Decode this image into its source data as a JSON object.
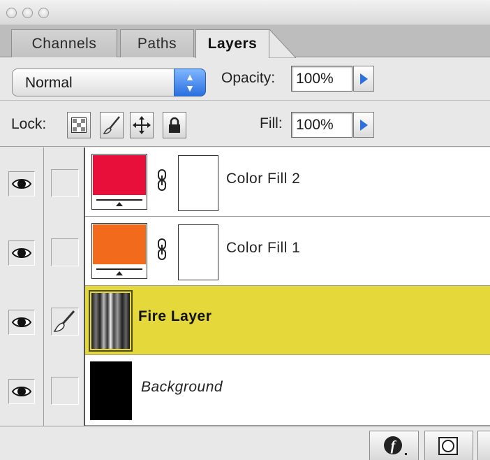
{
  "tabs": [
    {
      "label": "Channels"
    },
    {
      "label": "Paths"
    },
    {
      "label": "Layers"
    }
  ],
  "blend_mode": "Normal",
  "opacity": {
    "label": "Opacity:",
    "value": "100%"
  },
  "lock": {
    "label": "Lock:"
  },
  "fill": {
    "label": "Fill:",
    "value": "100%"
  },
  "layers": [
    {
      "name": "Color Fill 2",
      "swatch_color": "#e8103a",
      "visible": true,
      "selected": false
    },
    {
      "name": "Color Fill 1",
      "swatch_color": "#f26a1c",
      "visible": true,
      "selected": false
    },
    {
      "name": "Fire Layer",
      "visible": true,
      "selected": true,
      "highlight_color": "#e4d83a"
    },
    {
      "name": "Background",
      "swatch_color": "#000000",
      "visible": true,
      "selected": false
    }
  ],
  "icons": {
    "lock_transparent": "checkerboard-icon",
    "lock_image": "brush-icon",
    "lock_position": "move-icon",
    "lock_all": "padlock-icon",
    "visibility": "eye-icon",
    "link": "chain-link-icon",
    "bottom_styles": "layer-style-icon",
    "bottom_mask": "mask-icon"
  }
}
